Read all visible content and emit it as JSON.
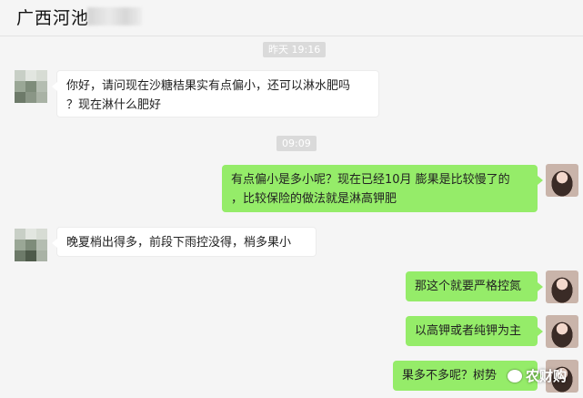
{
  "header": {
    "title": "广西河池"
  },
  "colors": {
    "bubble_right": "#95ec69",
    "bubble_left": "#ffffff",
    "timestamp_bg": "#dadada"
  },
  "messages": [
    {
      "type": "timestamp",
      "text": "昨天 19:16"
    },
    {
      "type": "incoming",
      "text": "你好，请问现在沙糖桔果实有点偏小，还可以淋水肥吗\n？现在淋什么肥好"
    },
    {
      "type": "timestamp",
      "text": "09:09"
    },
    {
      "type": "outgoing",
      "text": "有点偏小是多小呢？现在已经10月 膨果是比较慢了的\n，比较保险的做法就是淋高钾肥"
    },
    {
      "type": "incoming",
      "text": "晚夏梢出得多，前段下雨控没得，梢多果小"
    },
    {
      "type": "outgoing",
      "text": "那这个就要严格控氮"
    },
    {
      "type": "outgoing",
      "text": "以高钾或者纯钾为主"
    },
    {
      "type": "outgoing",
      "text": "果多不多呢？树势"
    }
  ],
  "watermark": {
    "text": "农财购",
    "icon": "wechat-icon"
  }
}
